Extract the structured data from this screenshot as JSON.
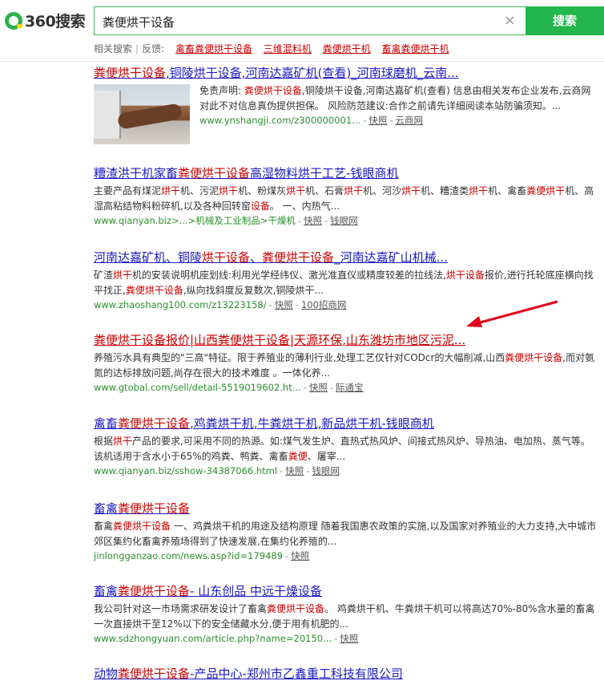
{
  "header": {
    "logo_text": "360搜索",
    "query": "粪便烘干设备",
    "search_button": "搜索",
    "clear": "×",
    "related_label": "相关搜索",
    "feedback_label": "反馈",
    "related_links": [
      "禽畜粪便烘干设备",
      "三维混料机",
      "粪便烘干机",
      "畜禽粪便烘干机"
    ]
  },
  "results": [
    {
      "title_parts": [
        {
          "t": "粪便烘干设备",
          "h": true
        },
        {
          "t": ",铜陵烘干设备,河南达嘉矿机(查看)_河南球磨机_云南...",
          "h": false
        }
      ],
      "snippet_parts": [
        {
          "t": "免责声明: ",
          "h": false
        },
        {
          "t": "粪便烘干设备",
          "h": true
        },
        {
          "t": ",铜陵烘干设备,河南达嘉矿机(查看) 信息由相关发布企业发布,云商网对此不对信息真伪提供担保。 风险防范建议:合作之前请先详细阅读本站防骗须知。...",
          "h": false
        }
      ],
      "url": "www.ynshangji.com/z300000001...",
      "links": [
        "快照",
        "云商网"
      ]
    },
    {
      "title_parts": [
        {
          "t": "糟渣洪干机家畜",
          "h": false
        },
        {
          "t": "粪便烘干设备",
          "h": true
        },
        {
          "t": "高湿物料烘干工艺-钱眼商机",
          "h": false
        }
      ],
      "snippet_parts": [
        {
          "t": "主要产品有煤泥",
          "h": false
        },
        {
          "t": "烘干",
          "h": true
        },
        {
          "t": "机、污泥",
          "h": false
        },
        {
          "t": "烘干",
          "h": true
        },
        {
          "t": "机、粉煤灰",
          "h": false
        },
        {
          "t": "烘干",
          "h": true
        },
        {
          "t": "机、石膏",
          "h": false
        },
        {
          "t": "烘干",
          "h": true
        },
        {
          "t": "机、河沙",
          "h": false
        },
        {
          "t": "烘干",
          "h": true
        },
        {
          "t": "机、糟渣类",
          "h": false
        },
        {
          "t": "烘干",
          "h": true
        },
        {
          "t": "机、禽畜",
          "h": false
        },
        {
          "t": "粪便烘干",
          "h": true
        },
        {
          "t": "机、高湿高粘结物料粉碎机,以及各种回转窑",
          "h": false
        },
        {
          "t": "设备",
          "h": true
        },
        {
          "t": "。 一、内热气...",
          "h": false
        }
      ],
      "url": "www.qianyan.biz>...>机械及工业制品>干燥机",
      "links": [
        "快照",
        "钱眼网"
      ]
    },
    {
      "title_parts": [
        {
          "t": "河南达嘉矿机、铜陵",
          "h": false
        },
        {
          "t": "烘干设备",
          "h": true
        },
        {
          "t": "、",
          "h": false
        },
        {
          "t": "粪便烘干设备",
          "h": true
        },
        {
          "t": "_河南达嘉矿山机械...",
          "h": false
        }
      ],
      "snippet_parts": [
        {
          "t": "矿渣",
          "h": false
        },
        {
          "t": "烘干",
          "h": true
        },
        {
          "t": "机的安装说明机座划线:利用光学经纬仪、激光准直仪或精度较差的拉线法,",
          "h": false
        },
        {
          "t": "烘干设备",
          "h": true
        },
        {
          "t": "报价,进行托轮底座横向找平找正,",
          "h": false
        },
        {
          "t": "粪便烘干设备",
          "h": true
        },
        {
          "t": ",纵向找斜度反复数次,铜陵烘干...",
          "h": false
        }
      ],
      "url": "www.zhaoshang100.com/z13223158/",
      "links": [
        "快照",
        "100招商网"
      ]
    },
    {
      "red_title": true,
      "title_parts": [
        {
          "t": "粪便烘干设备报价|山西粪便烘干设备|天源环保,山东潍坊市地区污泥...",
          "h": false
        }
      ],
      "snippet_parts": [
        {
          "t": "养殖污水具有典型的\"三高\"特征。限于养殖业的薄利行业,处理工艺仅针对CODcr的大幅削减,山西",
          "h": false
        },
        {
          "t": "粪便烘干设备",
          "h": true
        },
        {
          "t": ",而对氨氮的达标排放问题,尚存在很大的技术难度 。一体化养...",
          "h": false
        }
      ],
      "url": "www.gtobal.com/sell/detail-5519019602.ht...",
      "links": [
        "快照",
        "际通宝"
      ]
    },
    {
      "title_parts": [
        {
          "t": "禽畜",
          "h": false
        },
        {
          "t": "粪便烘干设备",
          "h": true
        },
        {
          "t": ",鸡粪烘干机,牛粪烘干机,新品烘干机-钱眼商机",
          "h": false
        }
      ],
      "snippet_parts": [
        {
          "t": "根据",
          "h": false
        },
        {
          "t": "烘干",
          "h": true
        },
        {
          "t": "产品的要求,可采用不同的热源。如:煤气发生炉、直热式热风炉、间接式热风炉、导热油、电加热、蒸气等。该机适用于含水小于65%的鸡粪、鸭粪、禽畜",
          "h": false
        },
        {
          "t": "粪便",
          "h": true
        },
        {
          "t": "、屠宰...",
          "h": false
        }
      ],
      "url": "www.qianyan.biz/sshow-34387066.html",
      "links": [
        "快照",
        "钱眼网"
      ]
    },
    {
      "title_parts": [
        {
          "t": "畜禽",
          "h": false
        },
        {
          "t": "粪便烘干设备",
          "h": true
        }
      ],
      "snippet_parts": [
        {
          "t": "畜禽",
          "h": false
        },
        {
          "t": "粪便烘干设备",
          "h": true
        },
        {
          "t": " 一、鸡粪烘干机的用途及结构原理 随着我国惠农政策的实施,以及国家对养殖业的大力支持,大中城市郊区集约化畜禽养殖场得到了快速发展,在集约化养殖的...",
          "h": false
        }
      ],
      "url": "jinlongganzao.com/news.asp?id=179489",
      "links": [
        "快照"
      ]
    },
    {
      "title_parts": [
        {
          "t": "畜禽",
          "h": false
        },
        {
          "t": "粪便烘干设备",
          "h": true
        },
        {
          "t": "- 山东创品 中远干燥设备",
          "h": false
        }
      ],
      "snippet_parts": [
        {
          "t": "我公司针对这一市场需求研发设计了畜禽",
          "h": false
        },
        {
          "t": "粪便烘干设备",
          "h": true
        },
        {
          "t": "。 鸡粪烘干机、牛粪烘干机可以将高达70%-80%含水量的畜禽一次直接烘干至12%以下的安全储藏水分,便于用有机肥的...",
          "h": false
        }
      ],
      "url": "www.sdzhongyuan.com/article.php?name=20150...",
      "links": [
        "快照"
      ]
    },
    {
      "title_parts": [
        {
          "t": "动物",
          "h": false
        },
        {
          "t": "粪便烘干设备",
          "h": true
        },
        {
          "t": "-产品中心-郑州市乙鑫重工科技有限公司",
          "h": false
        }
      ],
      "snippet_parts": [],
      "url": "",
      "links": []
    }
  ]
}
